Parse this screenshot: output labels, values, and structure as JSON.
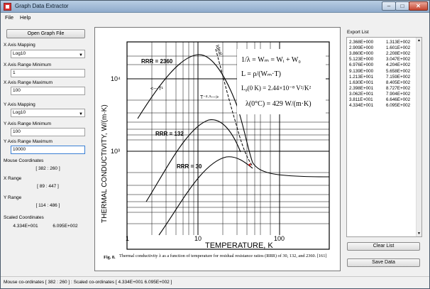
{
  "window": {
    "title": "Graph Data Extractor",
    "min": "–",
    "max": "□",
    "close": "✕"
  },
  "menu": [
    "File",
    "Help"
  ],
  "left": {
    "open_button": "Open Graph File",
    "x_mapping_label": "X Axis Mapping",
    "x_mapping_value": "Log10",
    "x_min_label": "X Axis Range Minimum",
    "x_min_value": "1",
    "x_max_label": "X Axis Range Maximum",
    "x_max_value": "100",
    "y_mapping_label": "Y Axis Mapping",
    "y_mapping_value": "Log10",
    "y_min_label": "Y Axis Range Minimum",
    "y_min_value": "100",
    "y_max_label": "Y Axis Range Maximum",
    "y_max_value": "10000",
    "mouse_label": "Mouse Coordinates",
    "mouse_value": "[ 382 : 260 ]",
    "xrange_label": "X Range",
    "xrange_value": "[ 89 : 447 ]",
    "yrange_label": "Y Range",
    "yrange_value": "[ 114 : 486 ]",
    "scaled_label": "Scaled Coordinates",
    "scaled_x": "4.334E+001",
    "scaled_y": "6.095E+002"
  },
  "graph": {
    "ylabel": "THERMAL CONDUCTIVITY, W/(m·K)",
    "xlabel": "TEMPERATURE, K",
    "xticks": [
      "1",
      "10",
      "100"
    ],
    "yticks": [
      "10⁴",
      "10³"
    ],
    "curve_labels": [
      "RRR = 2360",
      "RRR = 132",
      "RRR = 30"
    ],
    "ideal": "Ideal",
    "t_inv": "<---T¹",
    "t_pow": "T⁻²·³--->",
    "eq1": "1/λ = Wₘ = Wᵢ + W₀",
    "eq2": "L = ρ/(Wₘ·T)",
    "eq3": "L₀(0 K) = 2.44×10⁻⁸ V²/K²",
    "eq4": "λ(0°C) = 429 W/(m·K)",
    "caption_title": "Fig. 8.",
    "caption_text": "Thermal conductivity λ as a function of temperature for residual resistance ratios (RRR) of 30, 132, and 2360. [161]"
  },
  "export": {
    "label": "Export List",
    "rows": [
      [
        "2.368E+000",
        "1.313E+002"
      ],
      [
        "2.909E+000",
        "1.601E+002"
      ],
      [
        "3.860E+000",
        "2.208E+002"
      ],
      [
        "5.123E+000",
        "3.047E+002"
      ],
      [
        "6.976E+000",
        "4.204E+002"
      ],
      [
        "9.139E+000",
        "5.658E+002"
      ],
      [
        "1.213E+001",
        "7.159E+002"
      ],
      [
        "1.630E+001",
        "8.405E+002"
      ],
      [
        "2.398E+001",
        "8.727E+002"
      ],
      [
        "3.062E+001",
        "7.904E+002"
      ],
      [
        "3.811E+001",
        "6.646E+002"
      ],
      [
        "4.334E+001",
        "6.095E+002"
      ]
    ],
    "clear_button": "Clear List",
    "save_button": "Save Data"
  },
  "status": "Mouse co-ordinates [ 382 : 260 ] : Scaled co-ordinates [ 4.334E+001    6.095E+002 ]"
}
